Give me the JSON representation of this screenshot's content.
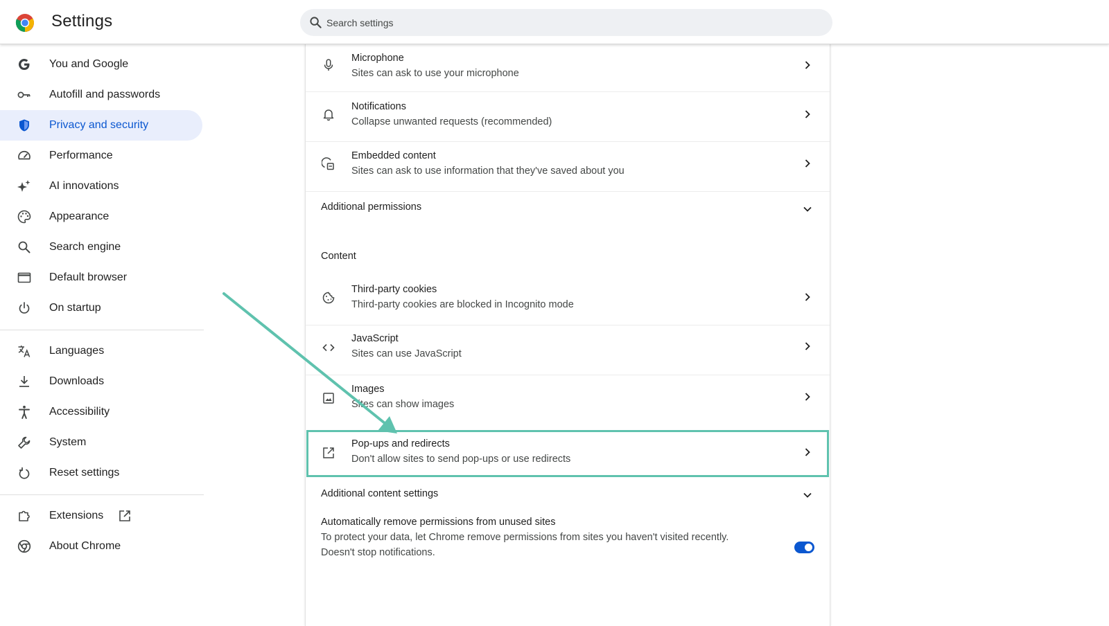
{
  "header": {
    "title": "Settings",
    "search_placeholder": "Search settings"
  },
  "sidebar": {
    "items": [
      {
        "label": "You and Google",
        "icon": "google-g-icon"
      },
      {
        "label": "Autofill and passwords",
        "icon": "key-icon"
      },
      {
        "label": "Privacy and security",
        "icon": "shield-icon",
        "active": true
      },
      {
        "label": "Performance",
        "icon": "speedometer-icon"
      },
      {
        "label": "AI innovations",
        "icon": "sparkle-icon"
      },
      {
        "label": "Appearance",
        "icon": "palette-icon"
      },
      {
        "label": "Search engine",
        "icon": "search-icon"
      },
      {
        "label": "Default browser",
        "icon": "browser-window-icon"
      },
      {
        "label": "On startup",
        "icon": "power-icon"
      },
      {
        "label": "Languages",
        "icon": "translate-icon"
      },
      {
        "label": "Downloads",
        "icon": "download-icon"
      },
      {
        "label": "Accessibility",
        "icon": "accessibility-icon"
      },
      {
        "label": "System",
        "icon": "wrench-icon"
      },
      {
        "label": "Reset settings",
        "icon": "reset-icon"
      },
      {
        "label": "Extensions",
        "icon": "puzzle-icon"
      },
      {
        "label": "About Chrome",
        "icon": "chrome-icon"
      }
    ]
  },
  "main": {
    "permissions": [
      {
        "title": "Microphone",
        "subtitle": "Sites can ask to use your microphone",
        "icon": "microphone-icon"
      },
      {
        "title": "Notifications",
        "subtitle": "Collapse unwanted requests (recommended)",
        "icon": "bell-icon"
      },
      {
        "title": "Embedded content",
        "subtitle": "Sites can ask to use information that they've saved about you",
        "icon": "embedded-content-icon"
      }
    ],
    "additional_permissions_label": "Additional permissions",
    "content_section_label": "Content",
    "content": [
      {
        "title": "Third-party cookies",
        "subtitle": "Third-party cookies are blocked in Incognito mode",
        "icon": "cookie-icon"
      },
      {
        "title": "JavaScript",
        "subtitle": "Sites can use JavaScript",
        "icon": "code-icon"
      },
      {
        "title": "Images",
        "subtitle": "Sites can show images",
        "icon": "image-icon"
      },
      {
        "title": "Pop-ups and redirects",
        "subtitle": "Don't allow sites to send pop-ups or use redirects",
        "icon": "open-in-new-icon",
        "highlighted": true
      }
    ],
    "additional_content_label": "Additional content settings",
    "auto_remove": {
      "title": "Automatically remove permissions from unused sites",
      "line1": "To protect your data, let Chrome remove permissions from sites you haven't visited recently.",
      "line2": "Doesn't stop notifications.",
      "enabled": true
    }
  },
  "colors": {
    "accent": "#0b57d0",
    "active_nav_bg": "#e9eefc",
    "highlight": "#5fc2ae",
    "annotation_arrow": "#5fc2ae"
  }
}
